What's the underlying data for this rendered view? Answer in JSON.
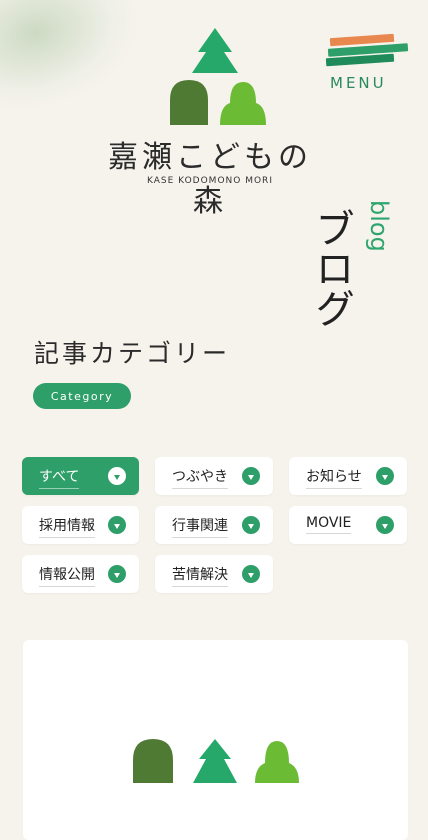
{
  "header": {
    "menu_label": "MENU",
    "menu_colors": [
      "#e8874e",
      "#2e9f68",
      "#1f8a5a"
    ]
  },
  "logo": {
    "title": "嘉瀬こどもの森",
    "subtitle": "KASE KODOMONO MORI",
    "colors": {
      "tree": "#25a86a",
      "dark_blob": "#4f7a34",
      "light_blob": "#6cbb35"
    }
  },
  "blog": {
    "english": "blog",
    "japanese": "ブログ"
  },
  "categories": {
    "title": "記事カテゴリー",
    "badge": "Category",
    "items": [
      {
        "label": "すべて",
        "active": true
      },
      {
        "label": "つぶやき",
        "active": false
      },
      {
        "label": "お知らせ",
        "active": false
      },
      {
        "label": "採用情報",
        "active": false
      },
      {
        "label": "行事関連",
        "active": false
      },
      {
        "label": "MOVIE",
        "active": false
      },
      {
        "label": "情報公開",
        "active": false
      },
      {
        "label": "苦情解決",
        "active": false
      }
    ]
  },
  "colors": {
    "accent": "#2e9f68",
    "background": "#f6f3ec"
  },
  "card": {
    "placeholder_icon": "kodomono-mori-logo-mark"
  }
}
